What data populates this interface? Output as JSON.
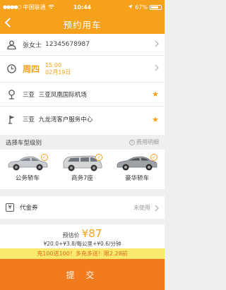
{
  "status_bar": {
    "carrier": "中国联通",
    "time": "10:44",
    "battery": "67%"
  },
  "nav": {
    "title": "预约用车"
  },
  "contact": {
    "name": "张女士",
    "phone": "12345678987"
  },
  "schedule": {
    "weekday": "周四",
    "time": "15:00",
    "date": "02月19日"
  },
  "pickup": {
    "city": "三亚",
    "place": "三亚凤凰国际机场"
  },
  "dropoff": {
    "city": "三亚",
    "place": "九龙湾客户服务中心"
  },
  "car_section": {
    "title": "选择车型级别",
    "fee_link": "费用明细"
  },
  "cars": [
    {
      "label": "公务轿车",
      "selected": true,
      "color": "#c9ccd0"
    },
    {
      "label": "商务7座",
      "selected": true,
      "color": "#d2d4d6"
    },
    {
      "label": "豪华轿车",
      "selected": true,
      "color": "#9ea2a6"
    }
  ],
  "coupon": {
    "icon": "¥",
    "label": "代金券",
    "state": "未使用"
  },
  "price": {
    "label": "预估价",
    "value": "¥87",
    "detail": "¥20.0+¥3.8/每公里+¥0.6/分钟"
  },
  "promo": {
    "text": "充100送100！多充多送！限2.28前"
  },
  "submit": {
    "label": "提 交"
  },
  "colors": {
    "accent": "#f6a11c",
    "submit": "#f27b1e",
    "promo_bg": "#fbe96e"
  }
}
